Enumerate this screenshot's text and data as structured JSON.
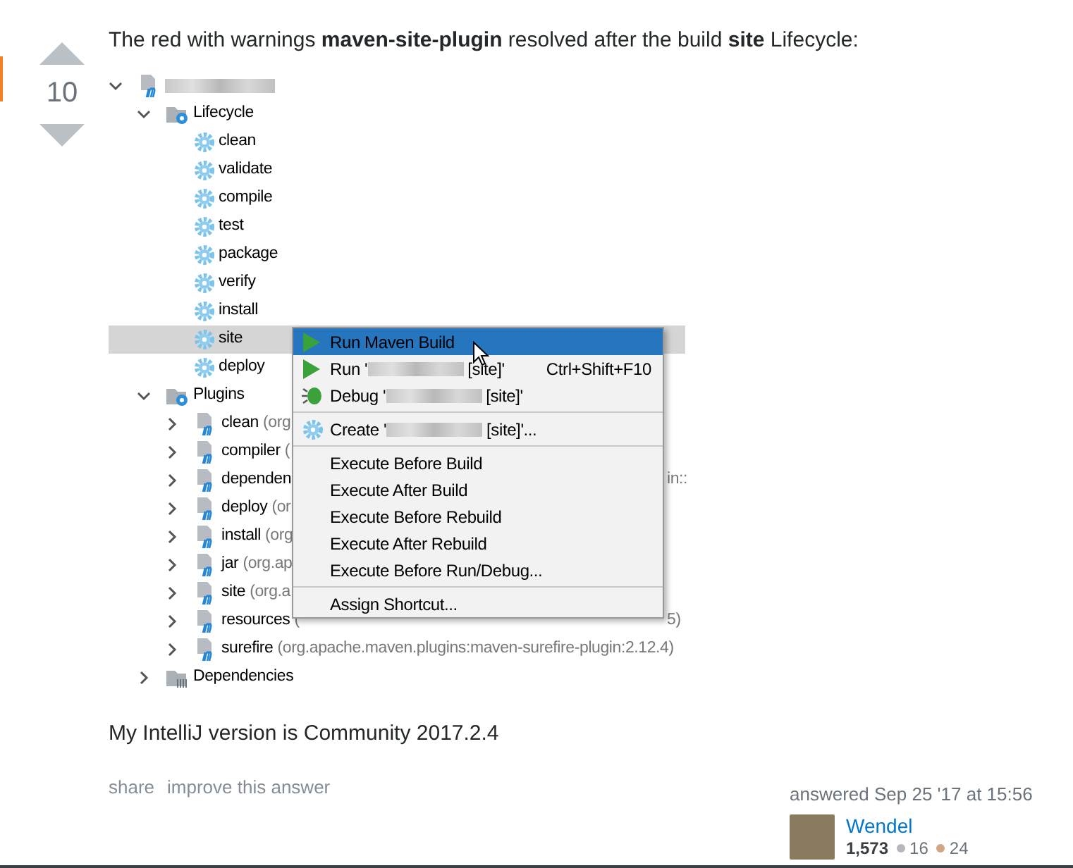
{
  "vote": {
    "score": "10"
  },
  "intro": "The red with warnings **maven-site-plugin** resolved after the build **site** Lifecycle:",
  "tree": [
    {
      "kind": "project",
      "expanded": true,
      "children": [
        {
          "kind": "lifecycle",
          "label": "Lifecycle",
          "expanded": true,
          "children": [
            {
              "kind": "goal",
              "label": "clean",
              "selected": false
            },
            {
              "kind": "goal",
              "label": "validate",
              "selected": false
            },
            {
              "kind": "goal",
              "label": "compile",
              "selected": false
            },
            {
              "kind": "goal",
              "label": "test",
              "selected": false
            },
            {
              "kind": "goal",
              "label": "package",
              "selected": false
            },
            {
              "kind": "goal",
              "label": "verify",
              "selected": false
            },
            {
              "kind": "goal",
              "label": "install",
              "selected": false
            },
            {
              "kind": "goal",
              "label": "site",
              "selected": true
            },
            {
              "kind": "goal",
              "label": "deploy",
              "selected": false
            }
          ]
        },
        {
          "kind": "plugins",
          "label": "Plugins",
          "expanded": true,
          "children": [
            {
              "kind": "plugin",
              "label": "clean",
              "detail": "(org",
              "expanded": false
            },
            {
              "kind": "plugin",
              "label": "compiler",
              "detail": "(",
              "expanded": false
            },
            {
              "kind": "plugin",
              "label": "dependen",
              "tail": "in::",
              "expanded": false
            },
            {
              "kind": "plugin",
              "label": "deploy",
              "detail": "(or",
              "expanded": false
            },
            {
              "kind": "plugin",
              "label": "install",
              "detail": "(org",
              "expanded": false
            },
            {
              "kind": "plugin",
              "label": "jar",
              "detail": "(org.ap",
              "expanded": false
            },
            {
              "kind": "plugin",
              "label": "site",
              "detail": "(org.a",
              "expanded": false
            },
            {
              "kind": "plugin",
              "label": "resources",
              "detail": "(",
              "tail": "5)",
              "expanded": false
            },
            {
              "kind": "plugin",
              "label": "surefire",
              "detail": "(org.apache.maven.plugins:maven-surefire-plugin:2.12.4)",
              "expanded": false
            }
          ]
        },
        {
          "kind": "dependencies",
          "label": "Dependencies",
          "expanded": false
        }
      ]
    }
  ],
  "menu": {
    "groups": [
      [
        {
          "kind": "run",
          "label": "Run Maven Build",
          "selected": true
        },
        {
          "kind": "run",
          "label": "Run '",
          "suffix": "[site]'",
          "redacted": true,
          "shortcut": "Ctrl+Shift+F10",
          "selected": false
        },
        {
          "kind": "debug",
          "label": "Debug '",
          "suffix": "[site]'",
          "redacted": true,
          "selected": false
        }
      ],
      [
        {
          "kind": "create",
          "label": "Create '",
          "suffix": "[site]'...",
          "redacted": true,
          "selected": false
        }
      ],
      [
        {
          "label": "Execute Before Build",
          "selected": false
        },
        {
          "label": "Execute After Build",
          "selected": false
        },
        {
          "label": "Execute Before Rebuild",
          "selected": false
        },
        {
          "label": "Execute After Rebuild",
          "selected": false
        },
        {
          "label": "Execute Before Run/Debug...",
          "selected": false
        }
      ],
      [
        {
          "label": "Assign Shortcut...",
          "selected": false
        }
      ]
    ]
  },
  "version_note": "My IntelliJ version is Community 2017.2.4",
  "links": [
    "share",
    "improve this answer"
  ],
  "signature": {
    "action": "answered Sep 25 '17 at 15:56",
    "user": "Wendel",
    "reputation": "1,573",
    "badges": [
      {
        "count": "16",
        "color": "#b4b8bc"
      },
      {
        "count": "24",
        "color": "#d1a684"
      }
    ]
  }
}
